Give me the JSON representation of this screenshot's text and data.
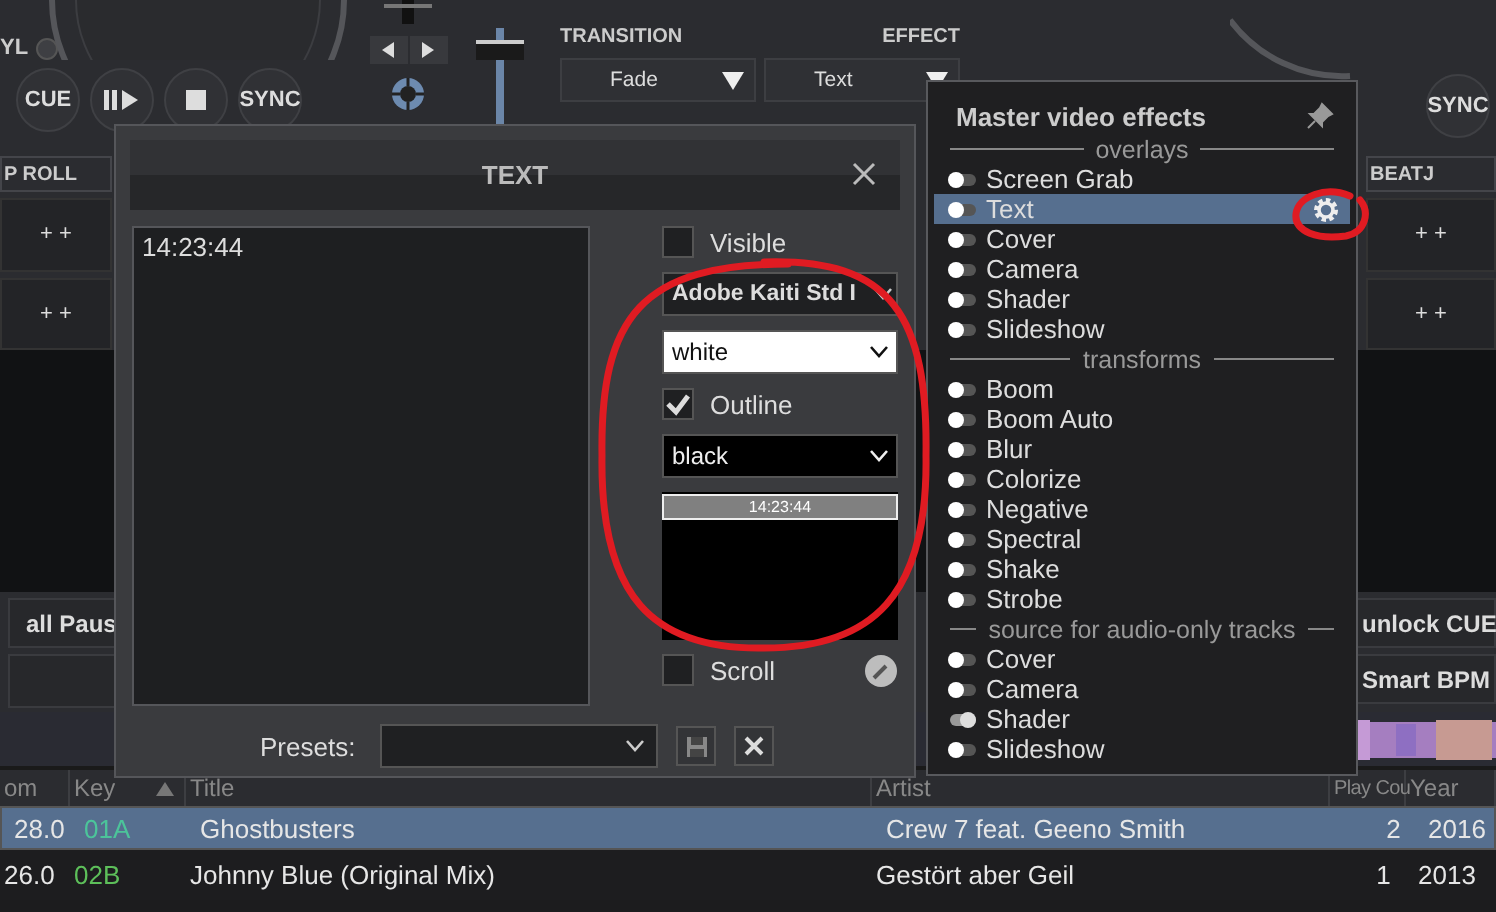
{
  "left_deck": {
    "vinyl_label": "YL",
    "transport": [
      {
        "kind": "text",
        "label": "CUE"
      },
      {
        "kind": "playpause"
      },
      {
        "kind": "stop"
      },
      {
        "kind": "text",
        "label": "SYNC"
      }
    ],
    "pad_mode": "P ROLL",
    "pads": [
      "+ +",
      "+ +"
    ]
  },
  "pitch_slider": {
    "level": 0.95
  },
  "volume_fader": {
    "level": 0.9
  },
  "mixer": {
    "transition_label": "TRANSITION",
    "effect_label": "EFFECT",
    "transition": "Fade",
    "effect": "Text"
  },
  "right_deck": {
    "sync": "SYNC",
    "pad_mode": "BEATJ",
    "pads": [
      "+ +",
      "+ +"
    ]
  },
  "deck_buttons": {
    "left": [
      "all Paus"
    ],
    "right": [
      "unlock CUE",
      "Smart BPM"
    ]
  },
  "browser": {
    "columns": [
      {
        "label": "om",
        "sorted": false
      },
      {
        "label": "Key",
        "sorted": true
      },
      {
        "label": "Title",
        "sorted": false
      },
      {
        "label": "Artist",
        "sorted": false
      },
      {
        "label": "Play Cou",
        "sorted": false
      },
      {
        "label": "Year",
        "sorted": false
      }
    ],
    "rows": [
      {
        "cells": [
          "28.0",
          "01A",
          "Ghostbusters",
          "Crew 7 feat. Geeno Smith",
          "2",
          "2016"
        ],
        "color": "#4cc49a",
        "selected": true
      },
      {
        "cells": [
          "26.0",
          "02B",
          "Johnny Blue (Original Mix)",
          "Gestört aber Geil",
          "1",
          "2013"
        ],
        "color": "#5dbf5a",
        "selected": false
      }
    ]
  },
  "text_dialog": {
    "title": "TEXT",
    "text": "14:23:44",
    "visible": {
      "label": "Visible",
      "checked": false
    },
    "font": "Adobe Kaiti Std I",
    "text_color": {
      "value": "white",
      "color": "#ffffff"
    },
    "outline": {
      "label": "Outline",
      "checked": true
    },
    "outline_color": {
      "value": "black",
      "color": "#000000"
    },
    "preview_text": "14:23:44",
    "scroll": {
      "label": "Scroll",
      "checked": false
    },
    "presets_label": "Presets:"
  },
  "effects_menu": {
    "title": "Master video effects",
    "sections": [
      {
        "title": "overlays",
        "items": [
          {
            "label": "Screen Grab",
            "on": false,
            "selected": false
          },
          {
            "label": "Text",
            "on": false,
            "selected": true
          },
          {
            "label": "Cover",
            "on": false,
            "selected": false
          },
          {
            "label": "Camera",
            "on": false,
            "selected": false
          },
          {
            "label": "Shader",
            "on": false,
            "selected": false
          },
          {
            "label": "Slideshow",
            "on": false,
            "selected": false
          }
        ]
      },
      {
        "title": "transforms",
        "items": [
          {
            "label": "Boom",
            "on": false,
            "selected": false
          },
          {
            "label": "Boom Auto",
            "on": false,
            "selected": false
          },
          {
            "label": "Blur",
            "on": false,
            "selected": false
          },
          {
            "label": "Colorize",
            "on": false,
            "selected": false
          },
          {
            "label": "Negative",
            "on": false,
            "selected": false
          },
          {
            "label": "Spectral",
            "on": false,
            "selected": false
          },
          {
            "label": "Shake",
            "on": false,
            "selected": false
          },
          {
            "label": "Strobe",
            "on": false,
            "selected": false
          }
        ]
      },
      {
        "title": "source for audio-only tracks",
        "items": [
          {
            "label": "Cover",
            "on": false,
            "selected": false
          },
          {
            "label": "Camera",
            "on": false,
            "selected": false
          },
          {
            "label": "Shader",
            "on": true,
            "selected": false
          },
          {
            "label": "Slideshow",
            "on": false,
            "selected": false
          }
        ]
      }
    ]
  },
  "annotations": [
    {
      "kind": "ring",
      "color": "#e01b22"
    },
    {
      "kind": "ring",
      "color": "#e01b22"
    }
  ]
}
